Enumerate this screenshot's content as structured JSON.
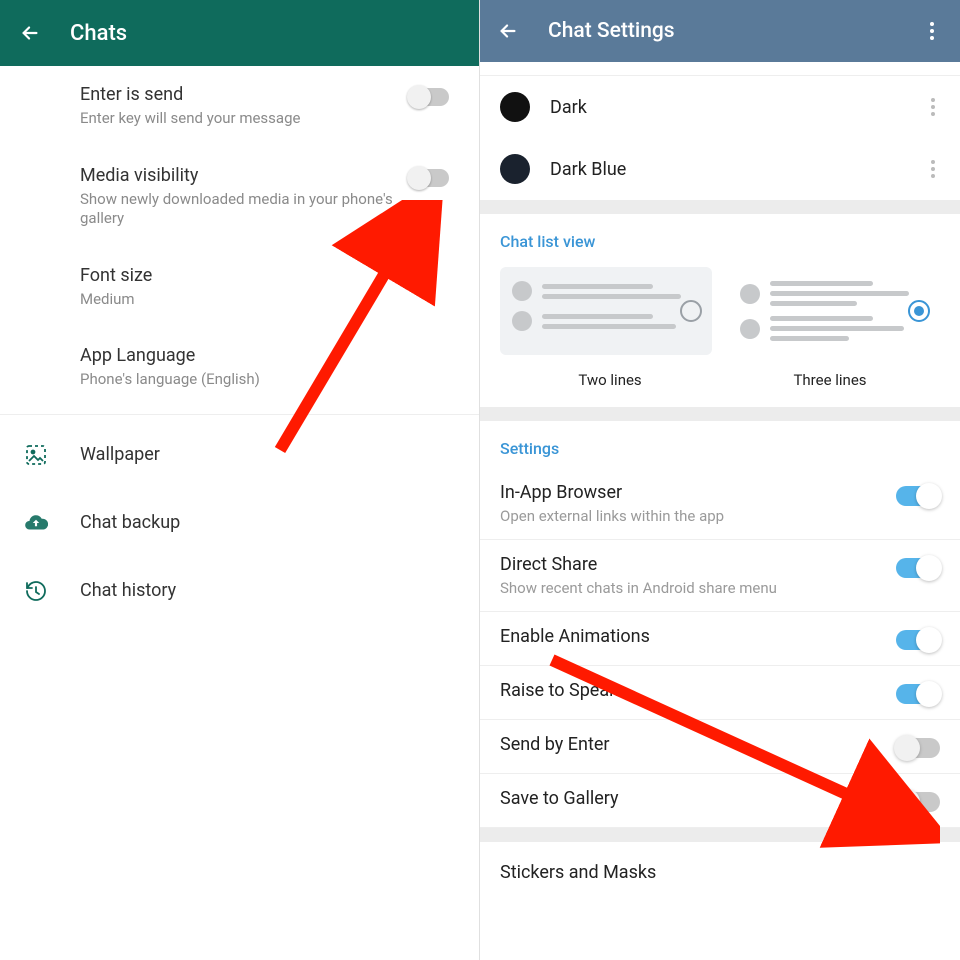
{
  "left": {
    "title": "Chats",
    "items": {
      "enter_send": {
        "label": "Enter is send",
        "sub": "Enter key will send your message"
      },
      "media_vis": {
        "label": "Media visibility",
        "sub": "Show newly downloaded media in your phone's gallery"
      },
      "font_size": {
        "label": "Font size",
        "sub": "Medium"
      },
      "app_lang": {
        "label": "App Language",
        "sub": "Phone's language (English)"
      }
    },
    "rows": {
      "wallpaper": "Wallpaper",
      "chat_backup": "Chat backup",
      "chat_history": "Chat history"
    }
  },
  "right": {
    "title": "Chat Settings",
    "themes": {
      "dark": "Dark",
      "dark_blue": "Dark Blue"
    },
    "chat_list_view": "Chat list view",
    "view_opts": {
      "two": "Two lines",
      "three": "Three lines"
    },
    "settings_header": "Settings",
    "settings": {
      "browser": {
        "label": "In-App Browser",
        "sub": "Open external links within the app"
      },
      "direct_share": {
        "label": "Direct Share",
        "sub": "Show recent chats in Android share menu"
      },
      "animations": {
        "label": "Enable Animations"
      },
      "raise": {
        "label": "Raise to Speak"
      },
      "send_enter": {
        "label": "Send by Enter"
      },
      "save_gallery": {
        "label": "Save to Gallery"
      }
    },
    "stickers": "Stickers and Masks"
  },
  "colors": {
    "dark": "#111111",
    "dark_blue": "#1a222e"
  }
}
